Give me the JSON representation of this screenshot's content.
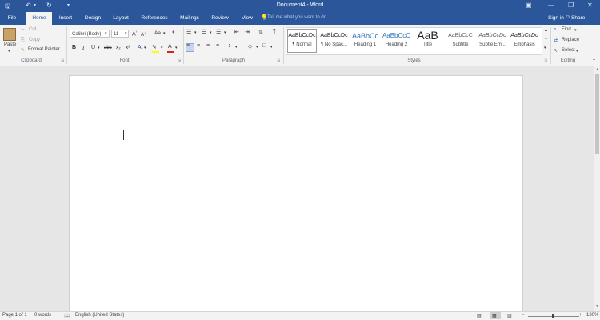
{
  "window": {
    "title": "Document4 - Word",
    "qat": {
      "save_icon": "save-icon",
      "undo_icon": "undo-icon",
      "redo_icon": "redo-icon",
      "customize_icon": "customize-qat-icon"
    },
    "controls": {
      "ribbon_display": "ribbon-display-icon",
      "minimize": "minimize-icon",
      "maximize": "maximize-icon",
      "close": "close-icon"
    }
  },
  "tabs": [
    {
      "label": "File",
      "active": false
    },
    {
      "label": "Home",
      "active": true
    },
    {
      "label": "Insert",
      "active": false
    },
    {
      "label": "Design",
      "active": false
    },
    {
      "label": "Layout",
      "active": false
    },
    {
      "label": "References",
      "active": false
    },
    {
      "label": "Mailings",
      "active": false
    },
    {
      "label": "Review",
      "active": false
    },
    {
      "label": "View",
      "active": false
    }
  ],
  "tellme_placeholder": "Tell me what you want to do...",
  "signin": "Sign in",
  "share": "Share",
  "clipboard": {
    "label": "Clipboard",
    "paste": "Paste",
    "cut": "Cut",
    "copy": "Copy",
    "format_painter": "Format Painter"
  },
  "font": {
    "label": "Font",
    "font_name": "Calibri (Body)",
    "font_size": "11",
    "bold": "B",
    "italic": "I",
    "underline": "U",
    "strikethrough": "abc",
    "subscript": "x₂",
    "superscript": "x²",
    "grow": "A",
    "shrink": "A",
    "change_case": "Aa",
    "text_effects": "A",
    "font_color": "A"
  },
  "paragraph": {
    "label": "Paragraph",
    "pilcrow": "¶"
  },
  "styles": {
    "label": "Styles",
    "items": [
      {
        "preview": "AaBbCcDc",
        "name": "¶ Normal"
      },
      {
        "preview": "AaBbCcDc",
        "name": "¶ No Spac..."
      },
      {
        "preview": "AaBbCc",
        "name": "Heading 1"
      },
      {
        "preview": "AaBbCcC",
        "name": "Heading 2"
      },
      {
        "preview": "AaB",
        "name": "Title"
      },
      {
        "preview": "AaBbCcC",
        "name": "Subtitle"
      },
      {
        "preview": "AaBbCcDc",
        "name": "Subtle Em..."
      },
      {
        "preview": "AaBbCcDc",
        "name": "Emphasis"
      }
    ]
  },
  "editing": {
    "label": "Editing",
    "find": "Find",
    "replace": "Replace",
    "select": "Select"
  },
  "status": {
    "page": "Page 1 of 1",
    "words": "0 words",
    "language": "English (United States)",
    "zoom": "130%"
  },
  "colors": {
    "brand": "#2b579a",
    "highlight": "#ffff00",
    "font_color": "#e01f1f"
  }
}
